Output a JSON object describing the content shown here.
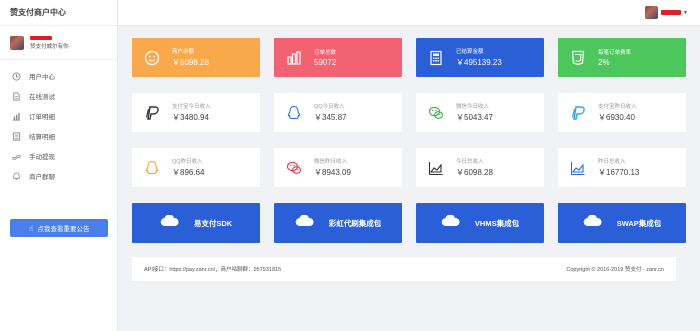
{
  "sidebar": {
    "brand": "赞支付商户中心",
    "user_role": "赞支付威尔有你-",
    "items": [
      {
        "label": "用户中心",
        "icon": "home-icon"
      },
      {
        "label": "在线测试",
        "icon": "doc-icon"
      },
      {
        "label": "订单明细",
        "icon": "chart-icon"
      },
      {
        "label": "结算明细",
        "icon": "list-icon"
      },
      {
        "label": "手动提现",
        "icon": "hand-icon"
      },
      {
        "label": "商户群聊",
        "icon": "bell-icon"
      }
    ],
    "notice_button": "点我查看重要公告"
  },
  "stats": [
    {
      "label": "商户余额",
      "value": "￥6098.28",
      "icon": "smiley-icon",
      "color": "#f7a94b"
    },
    {
      "label": "订单总数",
      "value": "59072",
      "icon": "bar-chart-icon",
      "color": "#f16272"
    },
    {
      "label": "已结算金额",
      "value": "￥495139.23",
      "icon": "calculator-icon",
      "color": "#2a5fd8"
    },
    {
      "label": "每笔订单费率",
      "value": "2%",
      "icon": "css3-icon",
      "color": "#4dc75d"
    }
  ],
  "income_today": [
    {
      "label": "支付宝今日收入",
      "value": "￥3480.94",
      "icon": "paypal-icon",
      "icon_color": "#333333"
    },
    {
      "label": "QQ今日收入",
      "value": "￥345.87",
      "icon": "qq-icon",
      "icon_color": "#2a6fe0"
    },
    {
      "label": "微信今日收入",
      "value": "￥5043.47",
      "icon": "wechat-icon",
      "icon_color": "#3cb34a"
    },
    {
      "label": "支付宝昨日收入",
      "value": "￥6930.40",
      "icon": "paypal-icon",
      "icon_color": "#2aa8e8"
    }
  ],
  "income_yesterday": [
    {
      "label": "QQ昨日收入",
      "value": "￥896.64",
      "icon": "qq-icon",
      "icon_color": "#f5a623"
    },
    {
      "label": "微信昨日收入",
      "value": "￥8943.09",
      "icon": "wechat-icon",
      "icon_color": "#e83a4a"
    },
    {
      "label": "今日总收入",
      "value": "￥6098.28",
      "icon": "area-chart-icon",
      "icon_color": "#333333"
    },
    {
      "label": "昨日总收入",
      "value": "￥16770.13",
      "icon": "area-chart-icon",
      "icon_color": "#2a6fe0"
    }
  ],
  "downloads": [
    {
      "label": "易支付SDK",
      "icon": "cloud-icon"
    },
    {
      "label": "彩虹代刷集成包",
      "icon": "cloud-icon"
    },
    {
      "label": "VHMS集成包",
      "icon": "cloud-icon"
    },
    {
      "label": "SWAP集成包",
      "icon": "cloud-icon"
    }
  ],
  "footer": {
    "left": "API接口：https://pay.zanr.cn/，商户咕聊群：957931815",
    "right": "Copyright © 2016-2019 赞支付 - zanr.cn"
  }
}
